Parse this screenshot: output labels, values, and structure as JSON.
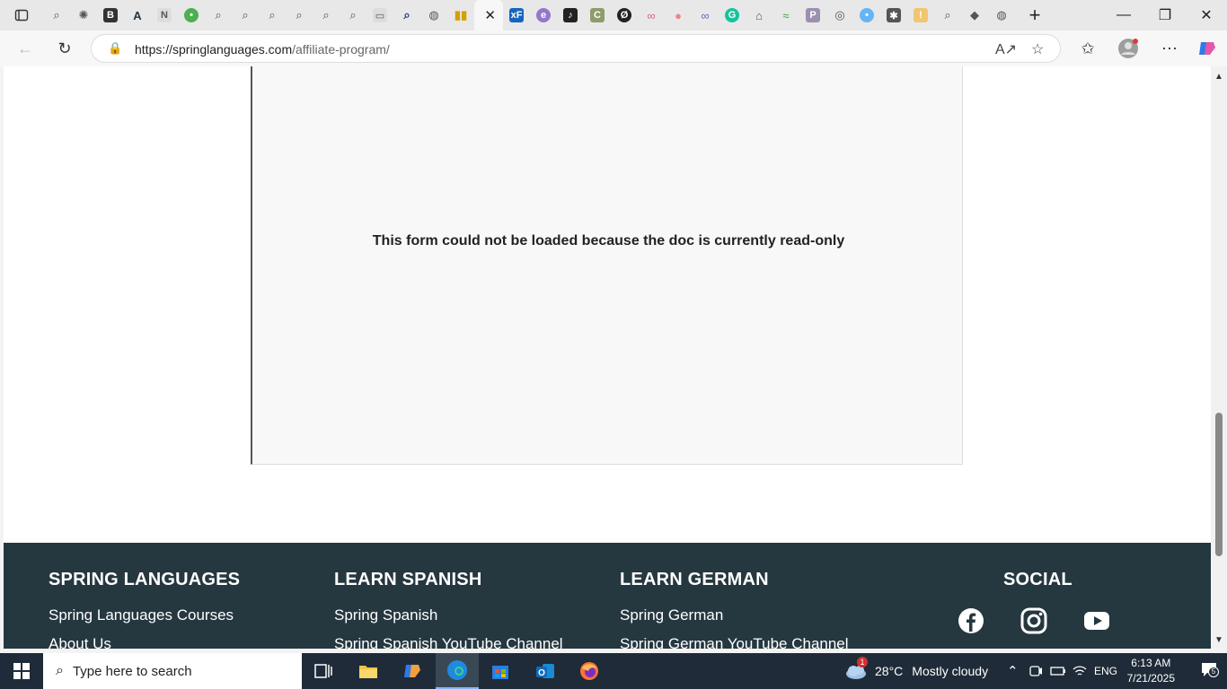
{
  "browser": {
    "url_host": "https://springlanguages.com",
    "url_path": "/affiliate-program/"
  },
  "page": {
    "form_message": "This form could not be loaded because the doc is currently read-only"
  },
  "footer": {
    "col1": {
      "heading": "SPRING LANGUAGES",
      "links": [
        "Spring Languages Courses",
        "About Us"
      ]
    },
    "col2": {
      "heading": "LEARN SPANISH",
      "links": [
        "Spring Spanish",
        "Spring Spanish YouTube Channel"
      ]
    },
    "col3": {
      "heading": "LEARN GERMAN",
      "links": [
        "Spring German",
        "Spring German YouTube Channel"
      ]
    },
    "col4": {
      "heading": "SOCIAL"
    },
    "social_icons": [
      "facebook-icon",
      "instagram-icon",
      "youtube-icon"
    ]
  },
  "taskbar": {
    "search_placeholder": "Type here to search",
    "weather_temp": "28°C",
    "weather_desc": "Mostly cloudy",
    "weather_badge": "1",
    "language": "ENG",
    "time": "6:13 AM",
    "date": "7/21/2025",
    "notification_count": "5"
  },
  "colors": {
    "footer_bg": "#25373f",
    "taskbar_bg": "#1f2b38"
  }
}
